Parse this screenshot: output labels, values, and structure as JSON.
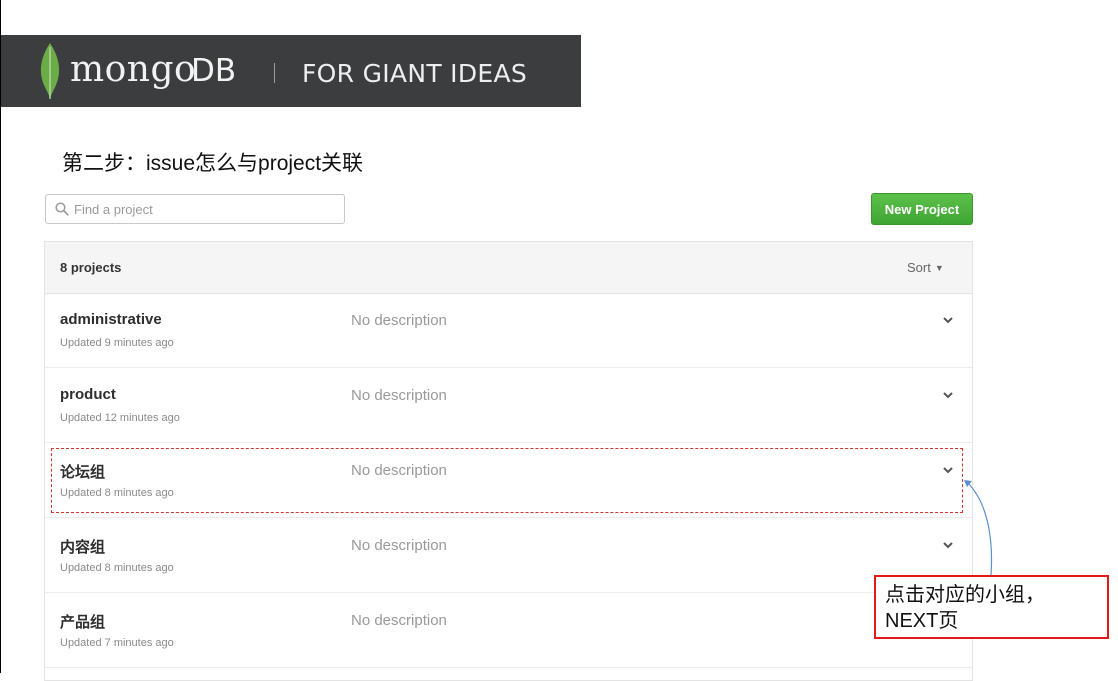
{
  "banner": {
    "logo_word": "mongo",
    "logo_db": "DB",
    "tagline": "FOR GIANT IDEAS",
    "background_color": "#3b3d3e",
    "leaf_color": "#6cac48"
  },
  "step_heading": "第二步：issue怎么与project关联",
  "search": {
    "placeholder": "Find a project",
    "value": "",
    "icon": "search-icon"
  },
  "new_project_label": "New Project",
  "panel": {
    "count_label": "8 projects",
    "sort_label": "Sort"
  },
  "projects": [
    {
      "name": "administrative",
      "updated": "Updated 9 minutes ago",
      "description": "No description"
    },
    {
      "name": "product",
      "updated": "Updated 12 minutes ago",
      "description": "No description"
    },
    {
      "name": "论坛组",
      "updated": "Updated 8 minutes ago",
      "description": "No description"
    },
    {
      "name": "内容组",
      "updated": "Updated 8 minutes ago",
      "description": "No description"
    },
    {
      "name": "产品组",
      "updated": "Updated 7 minutes ago",
      "description": "No description"
    }
  ],
  "callout": {
    "line1": "点击对应的小组，",
    "line2": "NEXT页",
    "border_color": "#e01919"
  },
  "colors": {
    "accent_green": "#4cb13e",
    "highlight_dashed": "#d0362c",
    "arrow": "#5b8fd1"
  }
}
